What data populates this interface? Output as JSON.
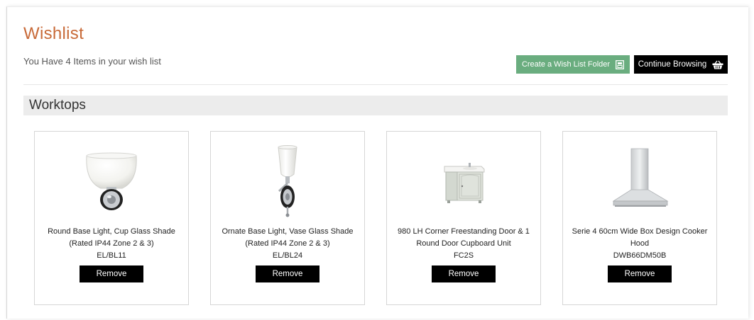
{
  "page": {
    "title": "Wishlist",
    "items_count_text": "You Have 4 Items in your wish list"
  },
  "actions": {
    "create_folder_label": "Create a Wish List Folder",
    "continue_browsing_label": "Continue Browsing",
    "folder_icon": "folder-icon",
    "basket_icon": "basket-icon"
  },
  "section": {
    "title": "Worktops"
  },
  "products": [
    {
      "name_line1": "Round Base Light, Cup Glass Shade",
      "name_line2": "(Rated IP44 Zone 2 & 3)",
      "code": "EL/BL11",
      "remove_label": "Remove",
      "image_icon": "cup-glass-wall-light-image"
    },
    {
      "name_line1": "Ornate Base Light, Vase Glass Shade",
      "name_line2": "(Rated IP44 Zone 2 & 3)",
      "code": "EL/BL24",
      "remove_label": "Remove",
      "image_icon": "vase-glass-wall-light-image"
    },
    {
      "name_line1": "980 LH Corner Freestanding Door & 1",
      "name_line2": "Round Door Cupboard Unit",
      "code": "FC2S",
      "remove_label": "Remove",
      "image_icon": "vanity-unit-image"
    },
    {
      "name_line1": "Serie 4 60cm Wide Box Design Cooker",
      "name_line2": "Hood",
      "code": "DWB66DM50B",
      "remove_label": "Remove",
      "image_icon": "cooker-hood-image"
    }
  ],
  "colors": {
    "title_accent": "#c86a38",
    "folder_button_bg": "#6aad7f",
    "dark_button_bg": "#000000",
    "section_bar_bg": "#ececec"
  }
}
